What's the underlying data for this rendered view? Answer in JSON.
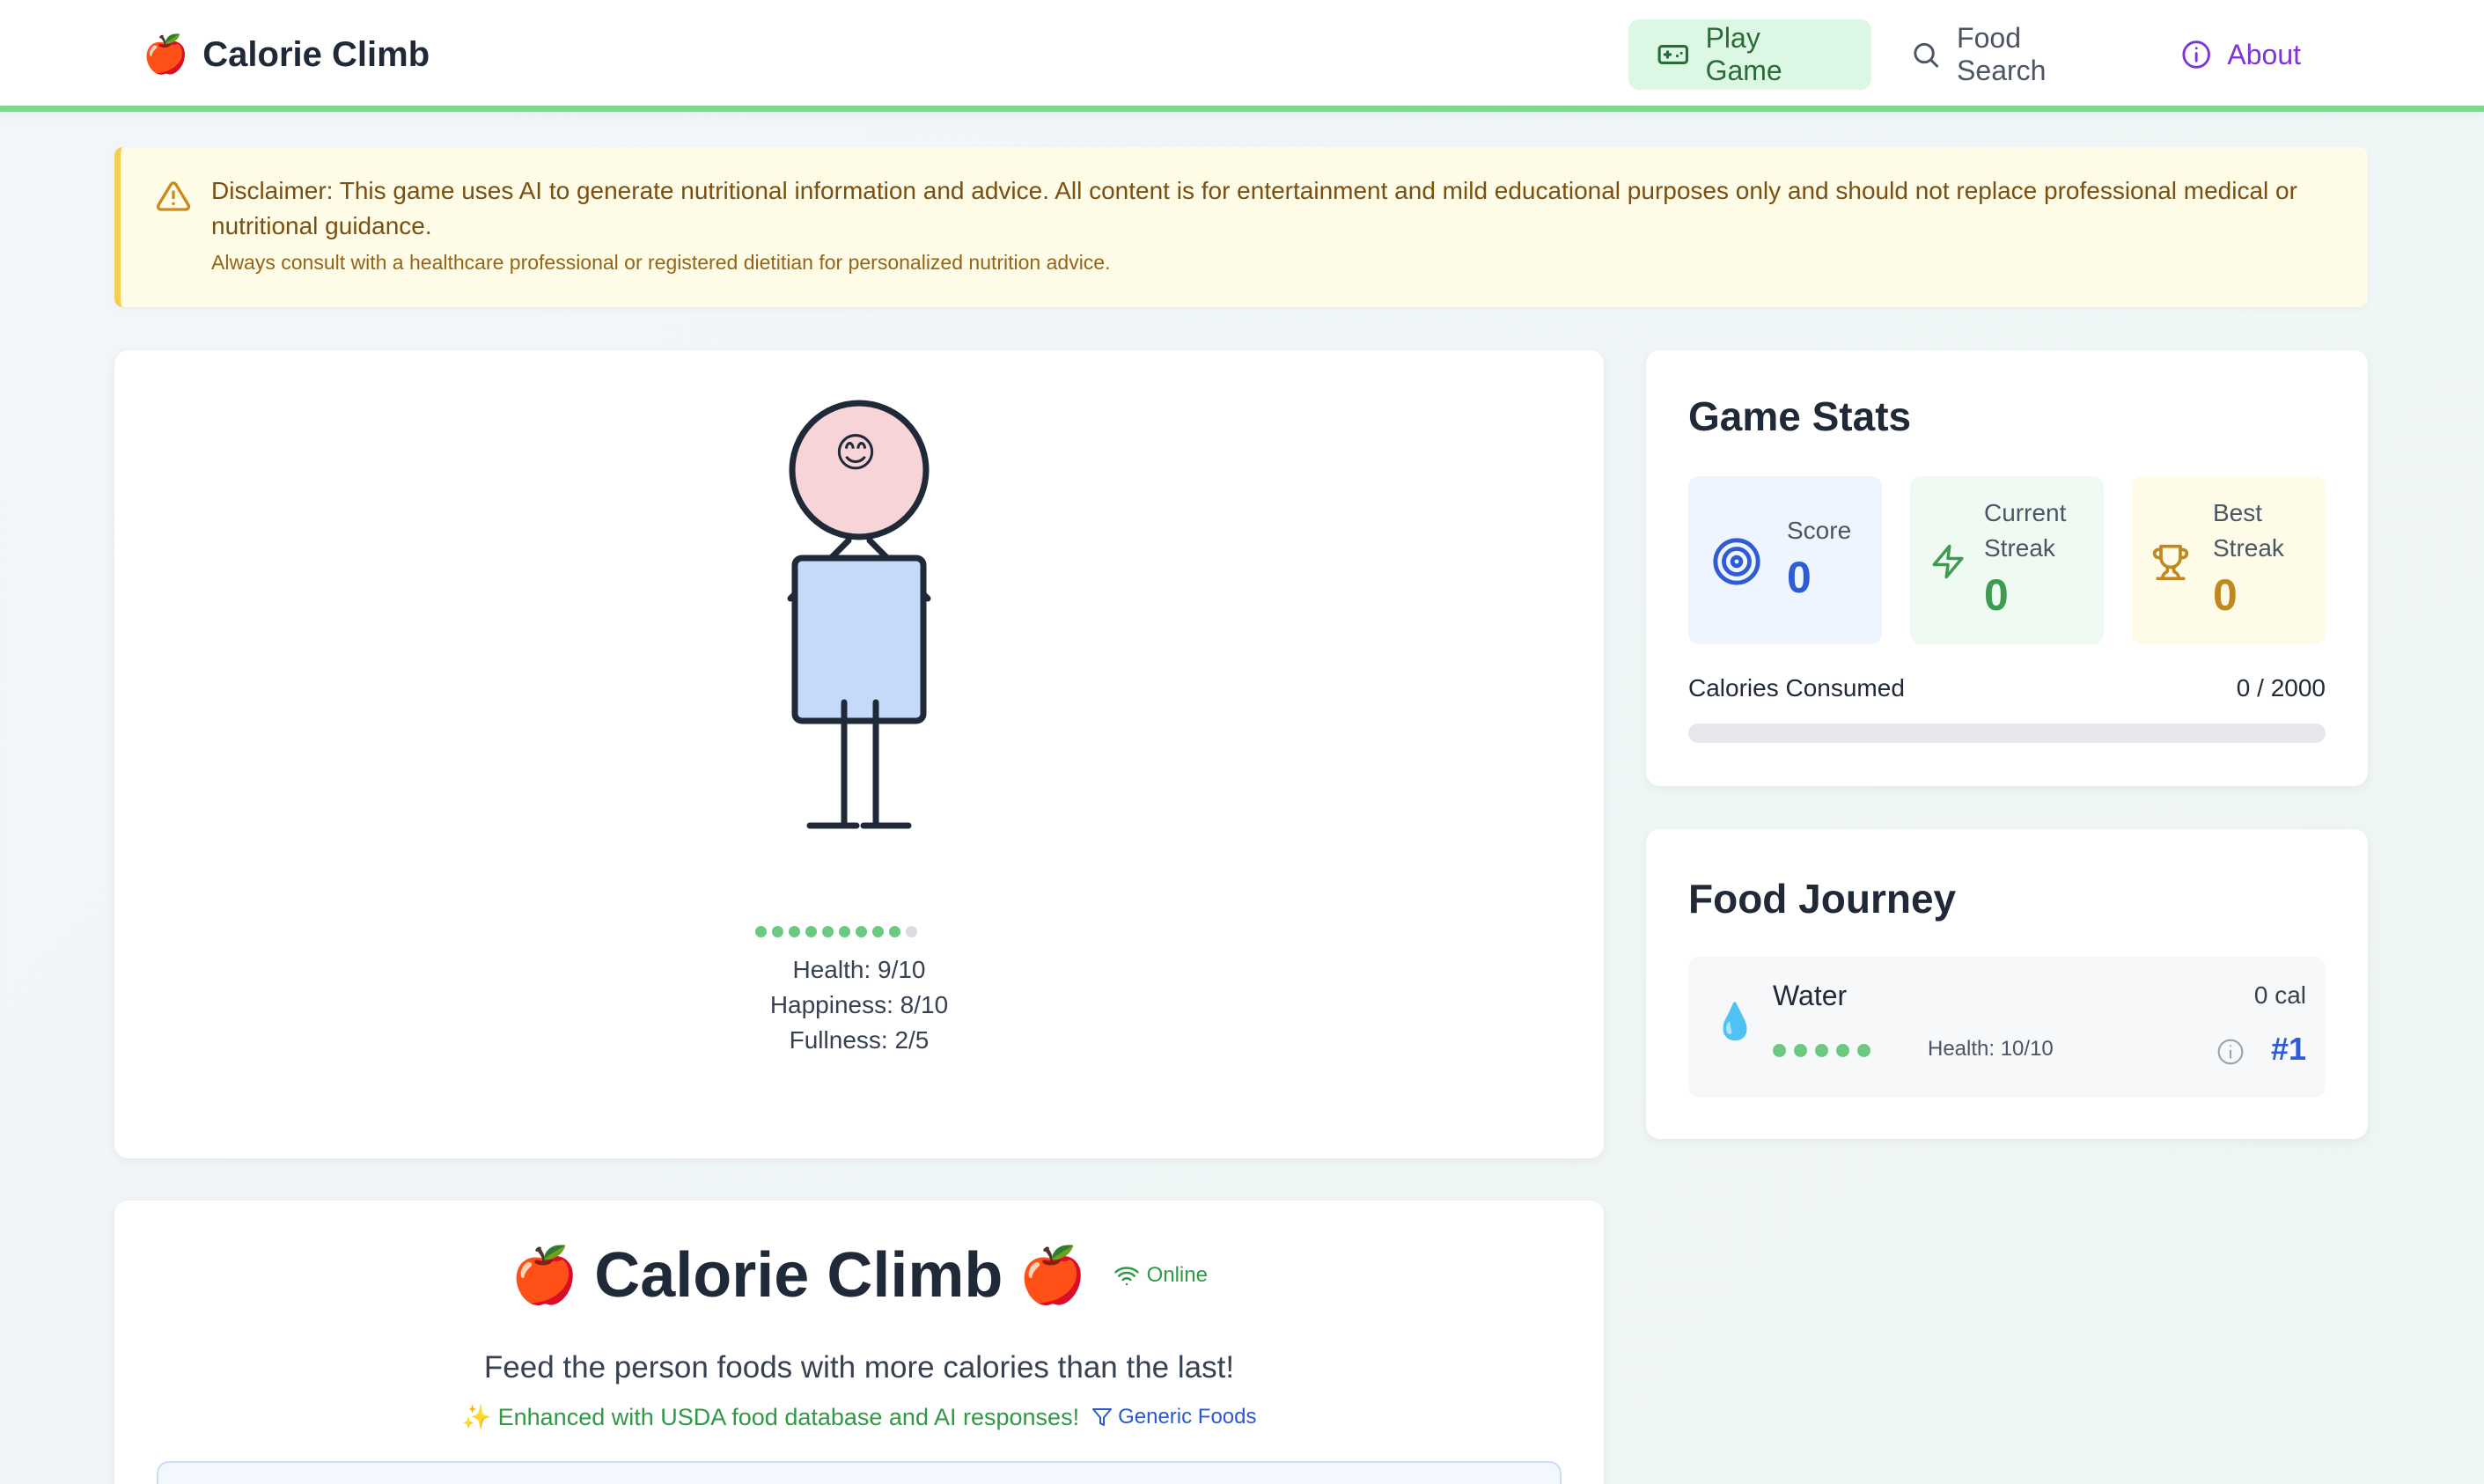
{
  "brand": {
    "emoji": "🍎",
    "name": "Calorie Climb"
  },
  "nav": {
    "play": "Play Game",
    "search": "Food Search",
    "about": "About"
  },
  "disclaimer": {
    "main": "Disclaimer: This game uses AI to generate nutritional information and advice. All content is for entertainment and mild educational purposes only and should not replace professional medical or nutritional guidance.",
    "sub": "Always consult with a healthcare professional or registered dietitian for personalized nutrition advice."
  },
  "person": {
    "face": "😊",
    "health_level": 9,
    "health_max": 10,
    "health": "Health: 9/10",
    "happiness": "Happiness: 8/10",
    "fullness": "Fullness: 2/5"
  },
  "stats": {
    "title": "Game Stats",
    "score_label": "Score",
    "score_value": "0",
    "streak_label_1": "Current",
    "streak_label_2": "Streak",
    "streak_value": "0",
    "best_label_1": "Best",
    "best_label_2": "Streak",
    "best_value": "0",
    "calories_label": "Calories Consumed",
    "calories_value": "0 / 2000",
    "calories_progress": 0
  },
  "journey": {
    "title": "Food Journey",
    "items": [
      {
        "icon": "💧",
        "name": "Water",
        "calories": "0 cal",
        "health": "Health: 10/10",
        "rank": "#1"
      }
    ]
  },
  "title_card": {
    "emoji": "🍎",
    "title": "Calorie Climb",
    "online": "Online",
    "tagline": "Feed the person foods with more calories than the last!",
    "enhanced": "✨ Enhanced with USDA food database and AI responses!",
    "filter": "Generic Foods"
  },
  "colors": {
    "accent_green": "#7dd88f",
    "score_blue": "#2f5bd6",
    "streak_green": "#3f9b4f",
    "best_gold": "#c0881e"
  }
}
